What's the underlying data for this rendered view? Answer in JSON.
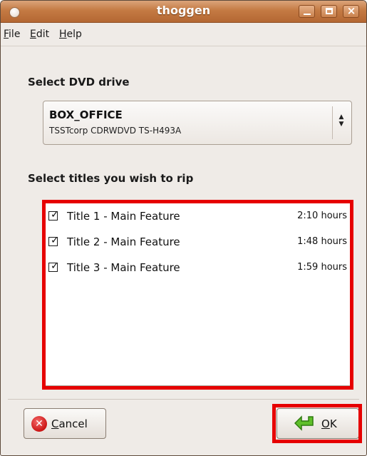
{
  "window": {
    "title": "thoggen"
  },
  "menu": {
    "file": {
      "mnemonic": "F",
      "rest": "ile"
    },
    "edit": {
      "mnemonic": "E",
      "rest": "dit"
    },
    "help": {
      "mnemonic": "H",
      "rest": "elp"
    }
  },
  "drive": {
    "heading": "Select DVD drive",
    "selected_name": "BOX_OFFICE",
    "selected_device": "TSSTcorp CDRWDVD TS-H493A"
  },
  "titles": {
    "heading": "Select titles you wish to rip",
    "items": [
      {
        "label": "Title 1 - Main Feature",
        "duration": "2:10 hours",
        "checked": true
      },
      {
        "label": "Title 2 - Main Feature",
        "duration": "1:48 hours",
        "checked": true
      },
      {
        "label": "Title 3 - Main Feature",
        "duration": "1:59 hours",
        "checked": true
      }
    ]
  },
  "buttons": {
    "cancel": {
      "mnemonic": "C",
      "rest": "ancel",
      "icon": "cancel-icon"
    },
    "ok": {
      "mnemonic": "O",
      "rest": "K",
      "icon": "ok-arrow-icon"
    }
  },
  "colors": {
    "titlebar": "#c47a43",
    "highlight": "#e60000",
    "window_bg": "#efebe7"
  }
}
